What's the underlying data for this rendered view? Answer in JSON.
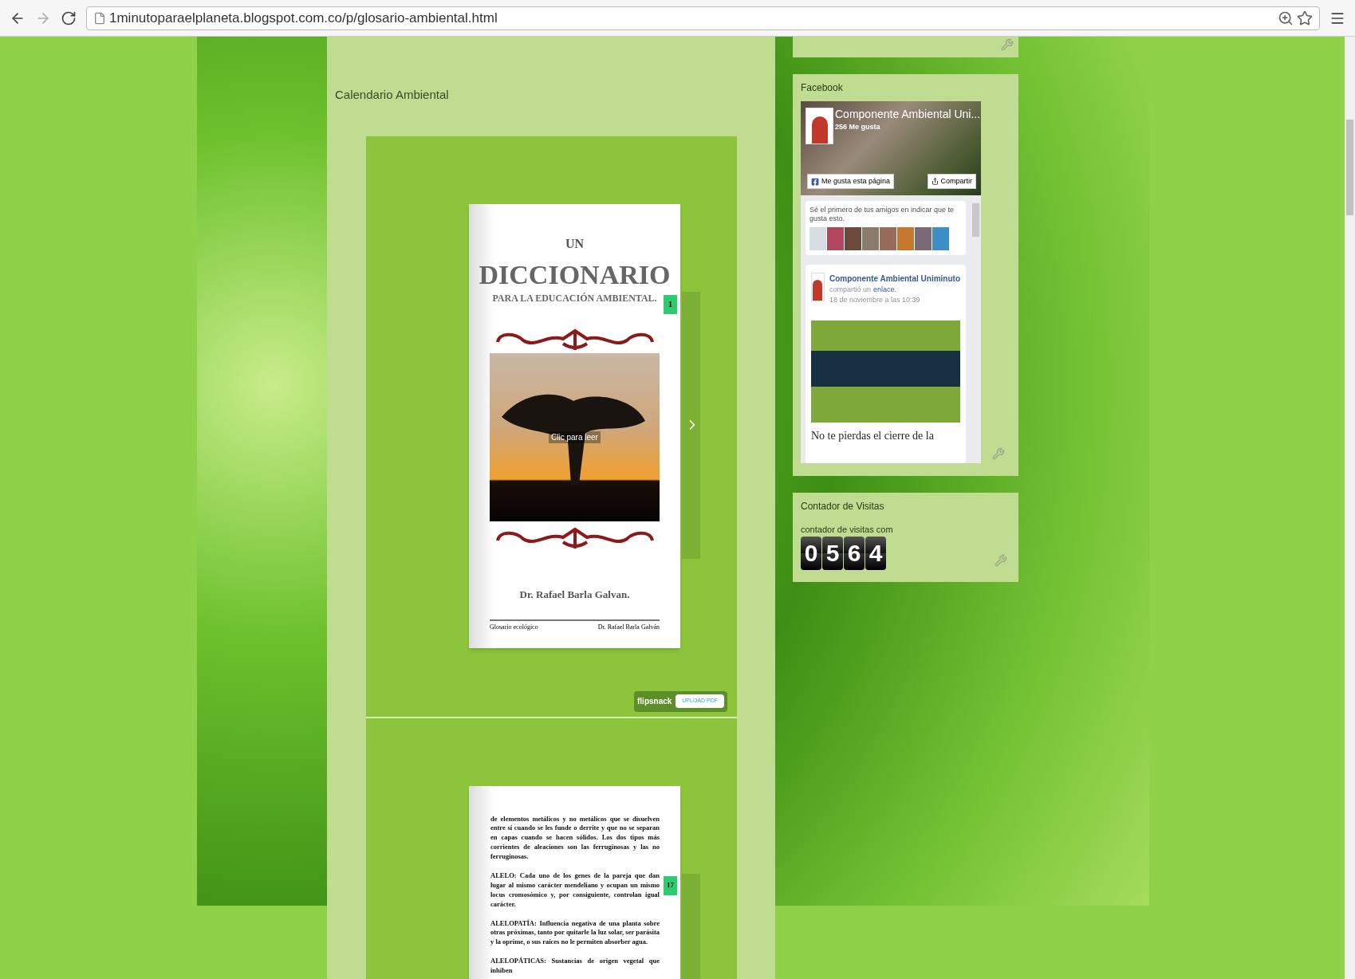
{
  "browser": {
    "url": "1minutoparaelplaneta.blogspot.com.co/p/glosario-ambiental.html"
  },
  "main": {
    "section_title": "Calendario Ambiental",
    "cover": {
      "pre_title": "UN",
      "title": "DICCIONARIO",
      "subtitle": "PARA LA EDUCACIÓN AMBIENTAL.",
      "page_number": "1",
      "overlay": "Clic para leer",
      "author": "Dr. Rafael Barla Galvan.",
      "footer_left": "Glosario ecológico",
      "footer_right": "Dr. Rafael Barla Galván"
    },
    "flipsnack": {
      "brand": "flipsnack",
      "button": "UPLOAD PDF"
    },
    "second_page": {
      "page_number": "17",
      "paragraphs": [
        "de elementos metálicos y no metálicos que se disuelven entre sí cuando se les funde o derrite y que no se separan en capas cuando se hacen sólidos. Los dos tipos más corrientes de aleaciones son las ferruginosas y las no ferruginosas.",
        "ALELO: Cada uno de los genes de la pareja que dan lugar al mismo carácter mendeliano y ocupan un mismo locus cromosómico y, por consiguiente, controlan igual carácter.",
        "ALELOPATÍA: Influencia negativa de una planta sobre otras próximas, tanto por quitarle la luz solar, ser parásita y la oprime, o sus raíces no le permiten absorber agua.",
        "ALELOPÁTICAS: Sustancias de origen vegetal que inhiben"
      ]
    }
  },
  "sidebar": {
    "facebook": {
      "title": "Facebook",
      "page_name": "Componente Ambiental Uni...",
      "likes": "256 Me gusta",
      "like_button": "Me gusta esta página",
      "share_button": "Compartir",
      "friends_text": "Sé el primero de tus amigos en indicar que te gusta esto.",
      "post": {
        "author": "Componente Ambiental Uniminuto",
        "action": "compartió un",
        "link": "enlace.",
        "date": "18 de noviembre a las 10:39",
        "headline": "No te pierdas el cierre de la"
      }
    },
    "counter": {
      "title": "Contador de Visitas",
      "label": "contador de visitas com",
      "digits": [
        "0",
        "5",
        "6",
        "4"
      ]
    }
  }
}
